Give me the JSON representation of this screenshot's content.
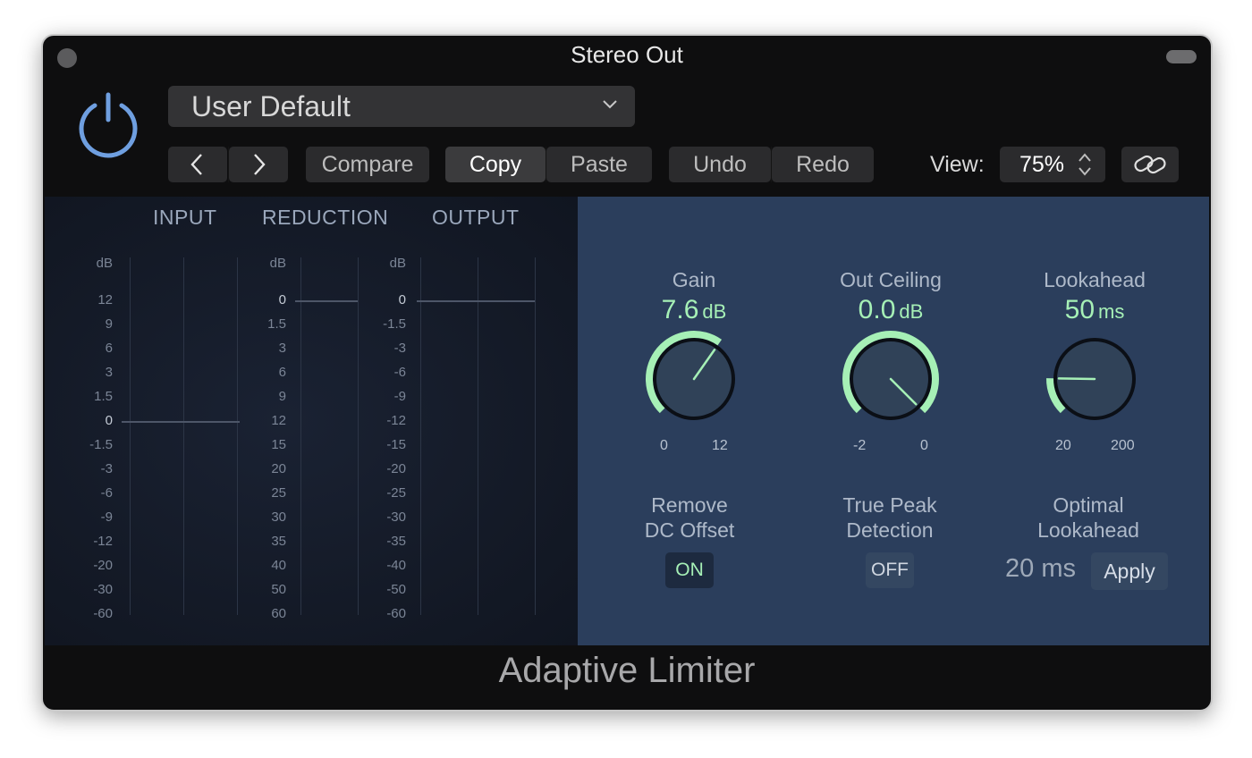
{
  "window": {
    "title": "Stereo Out"
  },
  "header": {
    "preset": "User Default",
    "buttons": {
      "compare": "Compare",
      "copy": "Copy",
      "paste": "Paste",
      "undo": "Undo",
      "redo": "Redo"
    },
    "view_label": "View:",
    "view_value": "75%"
  },
  "meters": {
    "headers": [
      "INPUT",
      "REDUCTION",
      "OUTPUT"
    ],
    "unit": "dB",
    "input_scale": [
      "12",
      "9",
      "6",
      "3",
      "1.5",
      "0",
      "-1.5",
      "-3",
      "-6",
      "-9",
      "-12",
      "-20",
      "-30",
      "-60"
    ],
    "reduction_scale": [
      "0",
      "1.5",
      "3",
      "6",
      "9",
      "12",
      "15",
      "20",
      "25",
      "30",
      "35",
      "40",
      "50",
      "60"
    ],
    "output_scale": [
      "0",
      "-1.5",
      "-3",
      "-6",
      "-9",
      "-12",
      "-15",
      "-20",
      "-25",
      "-30",
      "-35",
      "-40",
      "-50",
      "-60"
    ]
  },
  "controls": {
    "gain": {
      "label": "Gain",
      "value": "7.6",
      "unit": "dB",
      "min": "0",
      "max": "12",
      "fraction": 0.63
    },
    "out_ceiling": {
      "label": "Out Ceiling",
      "value": "0.0",
      "unit": "dB",
      "min": "-2",
      "max": "0",
      "fraction": 1.0
    },
    "lookahead": {
      "label": "Lookahead",
      "value": "50",
      "unit": "ms",
      "min": "20",
      "max": "200",
      "fraction": 0.17
    }
  },
  "switches": {
    "remove_dc": {
      "label_line1": "Remove",
      "label_line2": "DC Offset",
      "state": "ON"
    },
    "true_peak": {
      "label_line1": "True Peak",
      "label_line2": "Detection",
      "state": "OFF"
    },
    "optimal_lookahead": {
      "label_line1": "Optimal",
      "label_line2": "Lookahead",
      "value": "20 ms",
      "button": "Apply"
    }
  },
  "footer": {
    "plugin_name": "Adaptive Limiter"
  },
  "colors": {
    "accent_green": "#a6f0b6",
    "power_blue": "#6f9fe0",
    "panel_blue": "#2b3e5c"
  }
}
